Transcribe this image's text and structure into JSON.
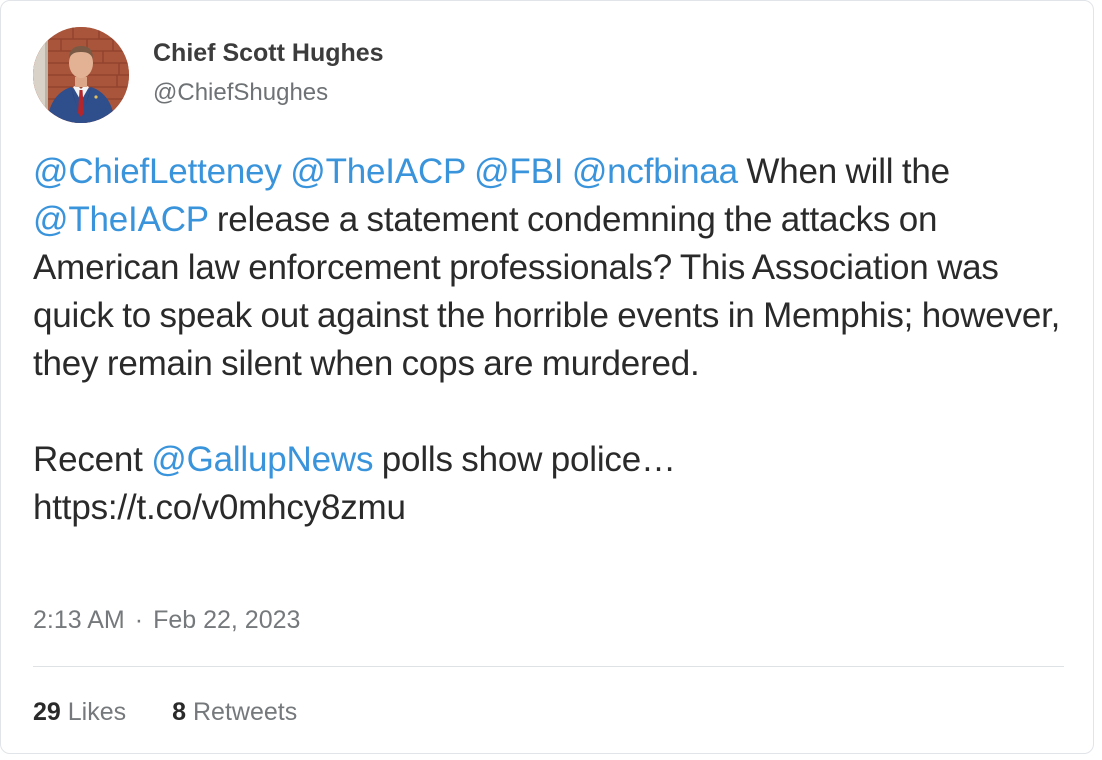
{
  "author": {
    "name": "Chief Scott Hughes",
    "handle": "@ChiefShughes"
  },
  "tweet": {
    "p1": {
      "m1": "@ChiefLetteney",
      "m2": "@TheIACP",
      "m3": "@FBI",
      "m4": "@ncfbinaa",
      "t1": " When will the ",
      "m5": "@TheIACP",
      "t2": " release a statement condemning the attacks on American law enforcement professionals? This Association was quick to speak out against the horrible events in Memphis; however, they remain silent when cops are murdered."
    },
    "p2": {
      "t1": "Recent ",
      "m1": "@GallupNews",
      "t2": " polls show police…",
      "link": "https://t.co/v0mhcy8zmu"
    }
  },
  "meta": {
    "time": "2:13 AM",
    "separator": "·",
    "date": "Feb 22, 2023"
  },
  "stats": {
    "likes_count": "29",
    "likes_label": "Likes",
    "retweets_count": "8",
    "retweets_label": "Retweets"
  },
  "colors": {
    "mention": "#3a94dc",
    "text": "#2a2a2a",
    "muted": "#76797c"
  }
}
